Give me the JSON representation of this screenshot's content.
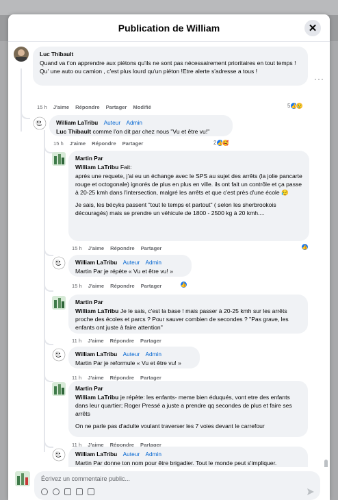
{
  "modal": {
    "title": "Publication de William",
    "close_label": "✕"
  },
  "comments": [
    {
      "author": "Luc Thibault",
      "badges": [],
      "text": "Quand va t'on apprendre aux piétons qu'ils ne sont pas nécessairement prioritaires en tout temps ! Qu' une auto ou camion , c'est plus lourd qu'un piéton !Etre alerte s'adresse a tous !",
      "time": "15 h",
      "actions": [
        "J'aime",
        "Répondre",
        "Partager",
        "Modifié"
      ],
      "reactions": "5"
    },
    {
      "author": "William LaTribu",
      "badges": [
        "Auteur",
        "Admin"
      ],
      "mention": "Luc Thibault",
      "text": " comme l'on dit par chez nous \"Vu et être vu!\"",
      "time": "15 h",
      "actions": [
        "J'aime",
        "Répondre",
        "Partager"
      ],
      "reactions": "2"
    },
    {
      "author": "Martin Par",
      "badges": [],
      "mention": "William LaTribu",
      "text": " Fait:",
      "para1": "après une requete, j'ai eu un échange avec le SPS au sujet des arrêts (la jolie pancarte rouge et octogonale) ignorés de plus en plus en ville. ils ont fait un contrôle et ça passe à 20-25 kmh dans l'intersection, malgré les arrêts et que c'est près d'une école 😥",
      "para2": "Je sais, les bécyks passent \"tout le temps et partout\" ( selon les sherbrookois découragés) mais se prendre un véhicule de 1800 - 2500 kg à 20 kmh....",
      "time": "15 h",
      "actions": [
        "J'aime",
        "Répondre",
        "Partager"
      ]
    },
    {
      "author": "William LaTribu",
      "badges": [
        "Auteur",
        "Admin"
      ],
      "text": "Martin Par je répète « Vu et être vu! »",
      "time": "15 h",
      "actions": [
        "J'aime",
        "Répondre",
        "Partager"
      ]
    },
    {
      "author": "Martin Par",
      "badges": [],
      "mention": "William LaTribu",
      "text": " Je le sais, c'est la base ! mais passer à 20-25 kmh sur les arrêts proche des écoles et parcs ? Pour sauver combien de secondes ? \"Pas grave, les enfants ont juste à faire attention\"",
      "time": "11 h",
      "actions": [
        "J'aime",
        "Répondre",
        "Partager"
      ]
    },
    {
      "author": "William LaTribu",
      "badges": [
        "Auteur",
        "Admin"
      ],
      "text": "Martin Par je reformule « Vu et être vu! »",
      "time": "11 h",
      "actions": [
        "J'aime",
        "Répondre",
        "Partager"
      ]
    },
    {
      "author": "Martin Par",
      "badges": [],
      "mention": "William LaTribu",
      "text": " je répète: les enfants- meme bien éduqués, vont etre des enfants dans leur quartier; Roger Pressé a juste a prendre qq secondes de plus et faire ses arrêts",
      "para2": "On ne parle pas d'adulte voulant traverser les 7 voies devant le carrefour",
      "time": "11 h",
      "actions": [
        "J'aime",
        "Répondre",
        "Partager"
      ]
    },
    {
      "author": "William LaTribu",
      "badges": [
        "Auteur",
        "Admin"
      ],
      "text": "Martin Par donne ton nom pour être brigadier. Tout le monde peut s'impliquer.",
      "time": "",
      "actions": []
    }
  ],
  "composer": {
    "placeholder": "Écrivez un commentaire public..."
  },
  "colors": {
    "link_blue": "#0064d1",
    "like_blue": "#1877f2",
    "bubble": "#f0f2f5"
  }
}
